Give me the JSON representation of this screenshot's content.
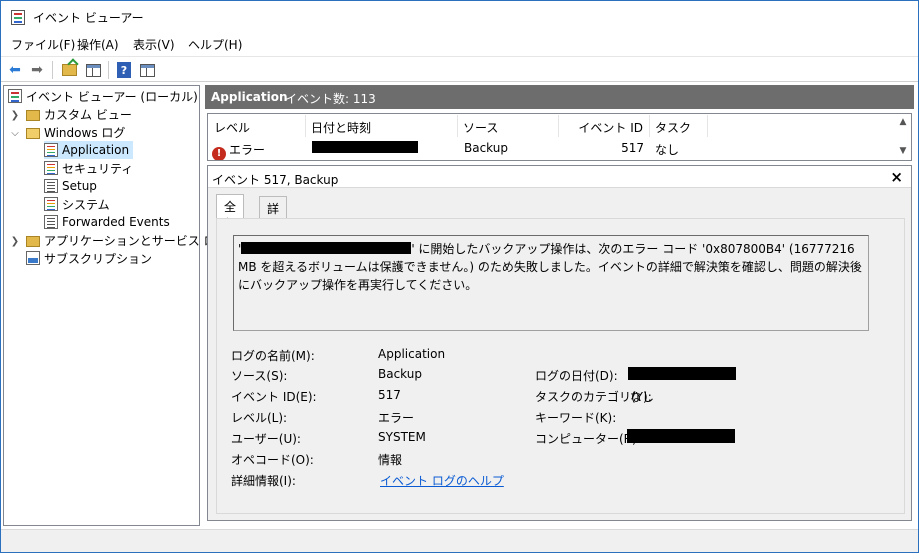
{
  "window": {
    "title": "イベント ビューアー"
  },
  "menu": [
    "ファイル(F)",
    "操作(A)",
    "表示(V)",
    "ヘルプ(H)"
  ],
  "toolbar": {
    "back_icon": "arrow-left-icon",
    "forward_icon": "arrow-right-icon",
    "help_label": "?"
  },
  "tree": {
    "root": "イベント ビューアー (ローカル)",
    "custom_views": "カスタム ビュー",
    "windows_logs": "Windows ログ",
    "logs": [
      "Application",
      "セキュリティ",
      "Setup",
      "システム",
      "Forwarded Events"
    ],
    "app_service_logs": "アプリケーションとサービス ログ",
    "subscriptions": "サブスクリプション"
  },
  "header": {
    "title": "Application",
    "count": "イベント数: 113"
  },
  "list": {
    "columns": [
      "レベル",
      "日付と時刻",
      "ソース",
      "イベント ID",
      "タスクの..."
    ],
    "rows": [
      {
        "level": "エラー",
        "datetime": "",
        "source": "Backup",
        "event_id": "517",
        "task": "なし"
      }
    ]
  },
  "detail": {
    "title": "イベント 517, Backup",
    "close": "×",
    "tabs": [
      "全般",
      "詳細"
    ],
    "message_prefix": "'",
    "message_body": "' に開始したバックアップ操作は、次のエラー コード '0x807800B4' (16777216 MB を超えるボリュームは保護できません。) のため失敗しました。イベントの詳細で解決策を確認し、問題の解決後にバックアップ操作を再実行してください。",
    "props": {
      "log_name_label": "ログの名前(M):",
      "log_name_value": "Application",
      "source_label": "ソース(S):",
      "source_value": "Backup",
      "logged_label": "ログの日付(D):",
      "event_id_label": "イベント ID(E):",
      "event_id_value": "517",
      "task_cat_label": "タスクのカテゴリ(Y):",
      "task_cat_value": "なし",
      "level_label": "レベル(L):",
      "level_value": "エラー",
      "keywords_label": "キーワード(K):",
      "user_label": "ユーザー(U):",
      "user_value": "SYSTEM",
      "computer_label": "コンピューター(R):",
      "opcode_label": "オペコード(O):",
      "opcode_value": "情報",
      "more_info_label": "詳細情報(I):",
      "more_info_link": "イベント ログのヘルプ"
    }
  },
  "colors": {
    "accent": "#2b6fbf",
    "header_bg": "#6d6d6d",
    "selected_bg": "#cce8ff",
    "error": "#c42b1c",
    "link": "#0a5bd3"
  }
}
